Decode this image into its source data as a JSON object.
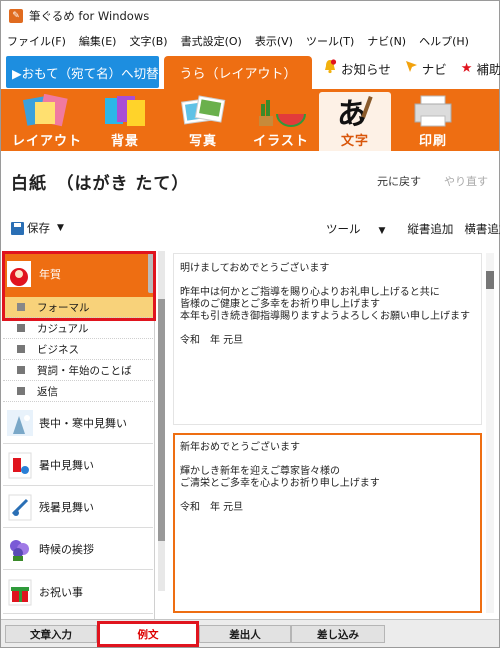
{
  "window": {
    "title": "筆ぐるめ for Windows"
  },
  "menubar": [
    "ファイル(F)",
    "編集(E)",
    "文字(B)",
    "書式設定(O)",
    "表示(V)",
    "ツール(T)",
    "ナビ(N)",
    "ヘルプ(H)"
  ],
  "mode_tabs": {
    "front": "▶おもて（宛て名）へ切替",
    "back": "うら（レイアウト）"
  },
  "top_links": {
    "notice": "お知らせ",
    "navi": "ナビ",
    "extra": "補助"
  },
  "toolbar": {
    "items": [
      "レイアウト",
      "背景",
      "写真",
      "イラスト",
      "文字",
      "印刷"
    ],
    "active": "文字"
  },
  "doc": {
    "title": "白紙　（はがき たて）",
    "undo": "元に戻す",
    "redo": "やり直す"
  },
  "toolbar2": {
    "save": "保存",
    "tools": "ツール",
    "vertical_add": "縦書追加",
    "horizontal_add": "横書追加"
  },
  "categories": [
    {
      "name": "年賀",
      "selected": true
    },
    {
      "name": "喪中・寒中見舞い"
    },
    {
      "name": "暑中見舞い"
    },
    {
      "name": "残暑見舞い"
    },
    {
      "name": "時候の挨拶"
    },
    {
      "name": "お祝い事"
    }
  ],
  "subcategories": [
    "フォーマル",
    "カジュアル",
    "ビジネス",
    "賀詞・年始のことば",
    "返信"
  ],
  "selected_subcategory": "フォーマル",
  "samples": [
    [
      "明けましておめでとうございます",
      "",
      "昨年中は何かとご指導を賜り心よりお礼申し上げると共に",
      "皆様のご健康とご多幸をお祈り申し上げます",
      "本年も引き続き御指導賜りますようよろしくお願い申し上げます",
      "",
      "令和　年 元旦"
    ],
    [
      "新年おめでとうございます",
      "",
      "輝かしき新年を迎えご尊家皆々様の",
      "ご清栄とご多幸を心よりお祈り申し上げます",
      "",
      "令和　年 元旦"
    ]
  ],
  "bottom_tabs": [
    "文章入力",
    "例文",
    "差出人",
    "差し込み"
  ],
  "active_bottom_tab": "例文",
  "colors": {
    "accent": "#ee6e12",
    "front_tab": "#1d8ee0",
    "highlight": "#e0141e",
    "selected_sub": "#f8d27a"
  }
}
